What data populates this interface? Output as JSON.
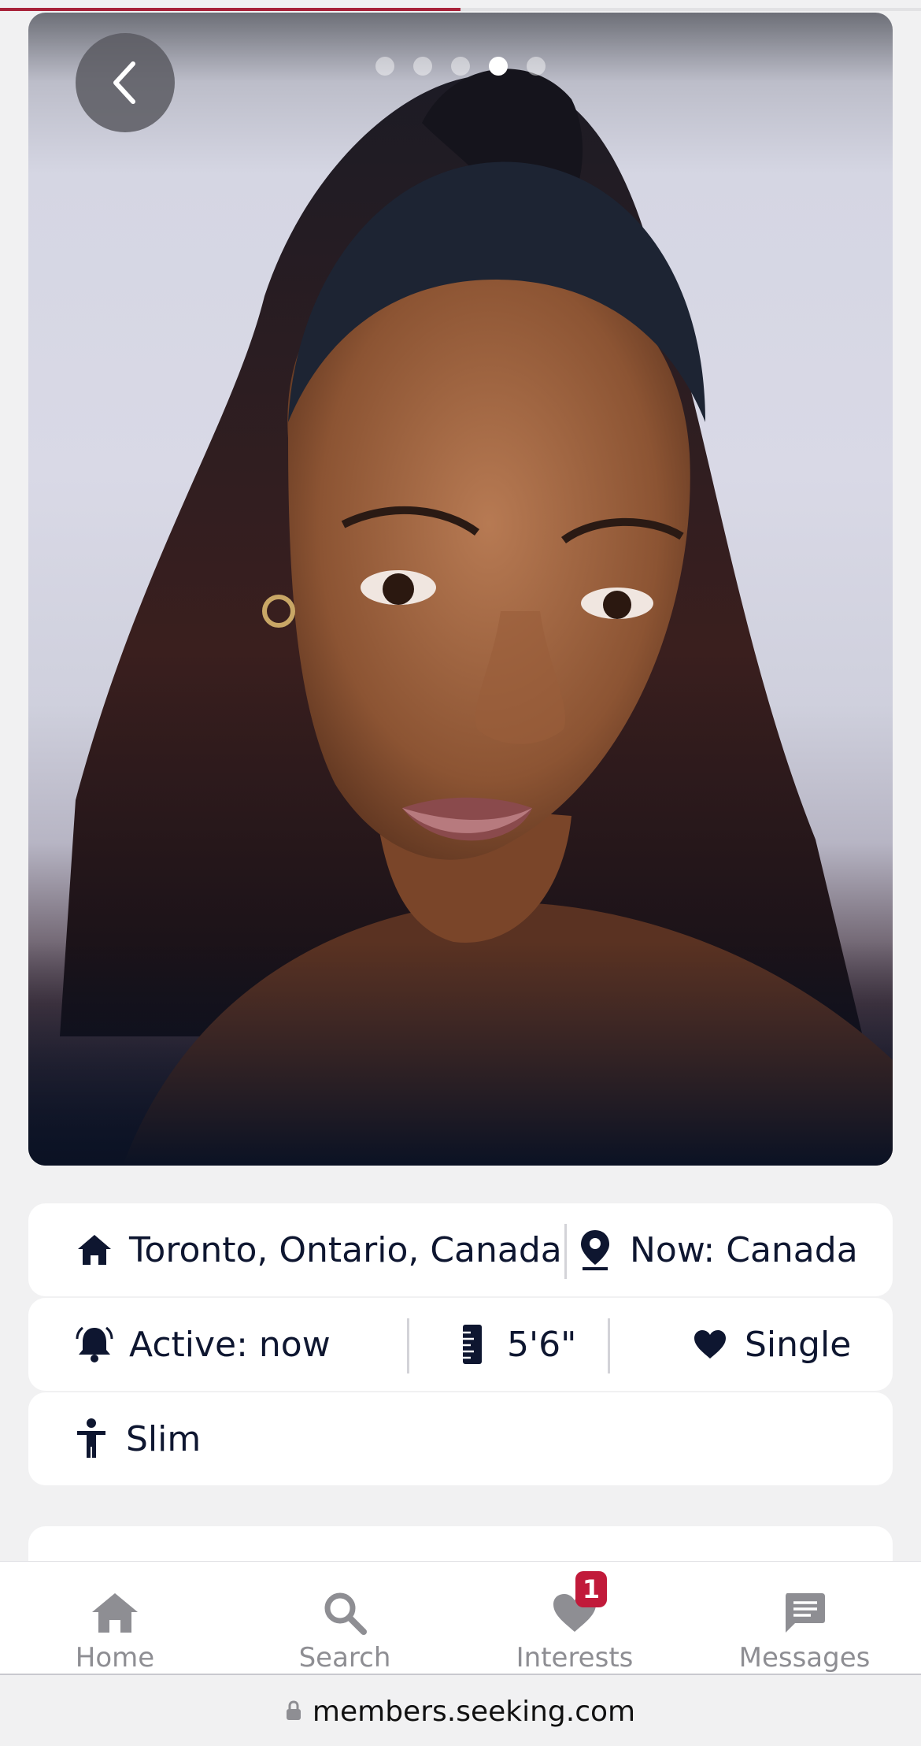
{
  "photo": {
    "total_photos": 5,
    "active_index": 3,
    "progress_fraction": 0.5
  },
  "details": {
    "home": "Toronto, Ontario, Canada",
    "current_location": "Now: Canada",
    "active": "Active: now",
    "height": "5'6\"",
    "relationship": "Single",
    "body_type": "Slim"
  },
  "nav": {
    "home": "Home",
    "search": "Search",
    "interests": "Interests",
    "interests_badge": "1",
    "messages": "Messages"
  },
  "browser": {
    "url": "members.seeking.com"
  },
  "colors": {
    "accent": "#a8233a",
    "badge": "#c11a3a",
    "text_dark": "#0e1630",
    "nav_inactive": "#8e8e93"
  },
  "icons": {
    "home": "home-icon",
    "location": "map-pin-icon",
    "active": "bell-icon",
    "height": "ruler-icon",
    "relationship": "heart-icon",
    "body": "person-icon",
    "back": "chevron-left-icon",
    "lock": "lock-icon"
  }
}
